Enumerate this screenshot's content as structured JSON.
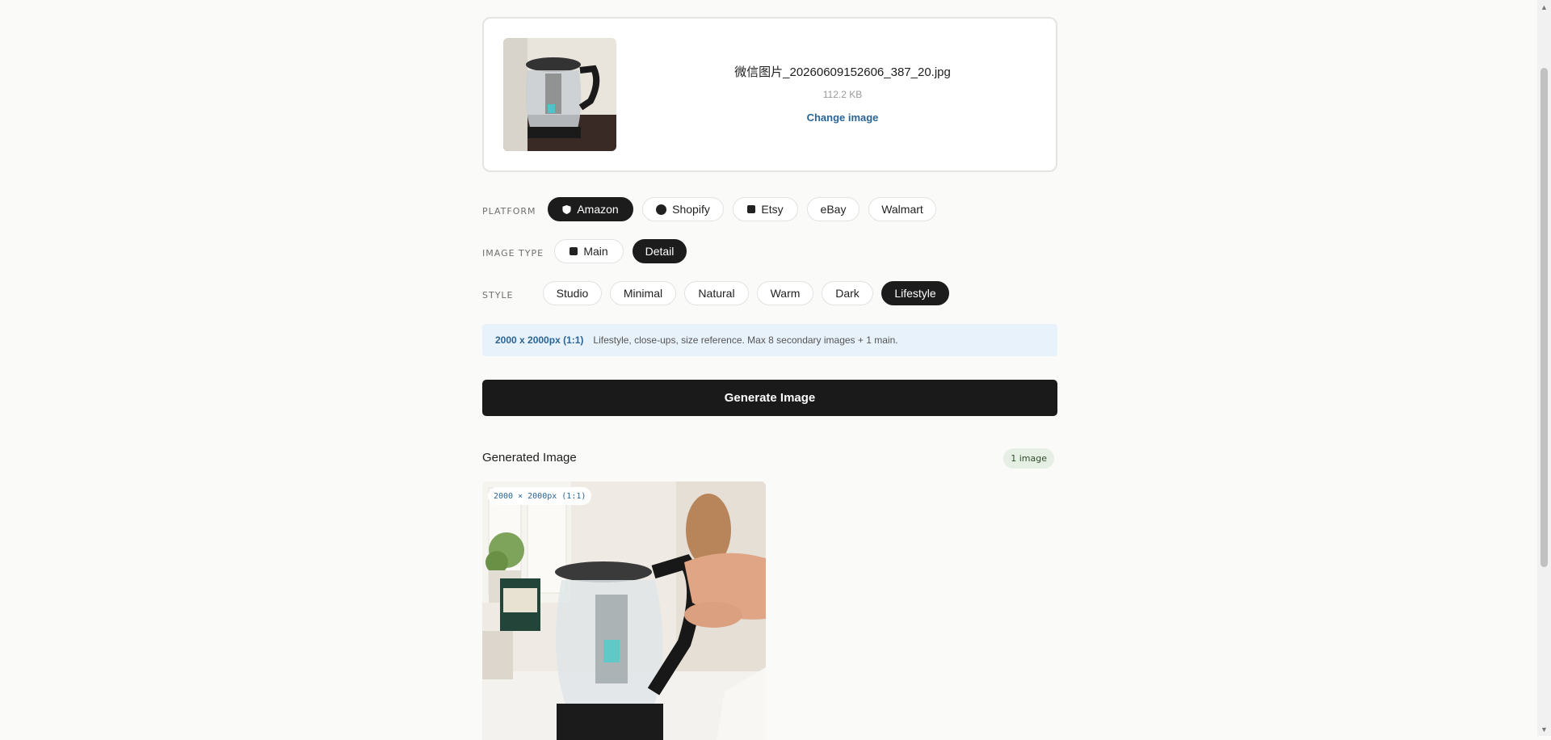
{
  "upload": {
    "file_name": "微信图片_20260609152606_387_20.jpg",
    "file_size": "112.2 KB",
    "change_label": "Change image"
  },
  "platform": {
    "label": "PLATFORM",
    "options": [
      {
        "label": "Amazon",
        "icon": "shield-icon",
        "active": true
      },
      {
        "label": "Shopify",
        "icon": "circle-icon",
        "active": false
      },
      {
        "label": "Etsy",
        "icon": "square-icon",
        "active": false
      },
      {
        "label": "eBay",
        "active": false
      },
      {
        "label": "Walmart",
        "active": false
      }
    ]
  },
  "image_type": {
    "label": "IMAGE TYPE",
    "options": [
      {
        "label": "Main",
        "icon": "square-icon",
        "active": false
      },
      {
        "label": "Detail",
        "active": true
      }
    ]
  },
  "style": {
    "label": "STYLE",
    "options": [
      {
        "label": "Studio",
        "active": false
      },
      {
        "label": "Minimal",
        "active": false
      },
      {
        "label": "Natural",
        "active": false
      },
      {
        "label": "Warm",
        "active": false
      },
      {
        "label": "Dark",
        "active": false
      },
      {
        "label": "Lifestyle",
        "active": true
      }
    ]
  },
  "info": {
    "dimensions": "2000 x 2000px (1:1)",
    "description": "Lifestyle, close-ups, size reference. Max 8 secondary images + 1 main."
  },
  "generate_label": "Generate Image",
  "generated": {
    "title": "Generated Image",
    "badge": "1 image",
    "size_tag": "2000 × 2000px (1:1)"
  },
  "colors": {
    "accent_dark": "#1c1c1c",
    "link_blue": "#2a6496",
    "info_bg": "#e8f2fb",
    "badge_bg": "#e6efe4"
  }
}
